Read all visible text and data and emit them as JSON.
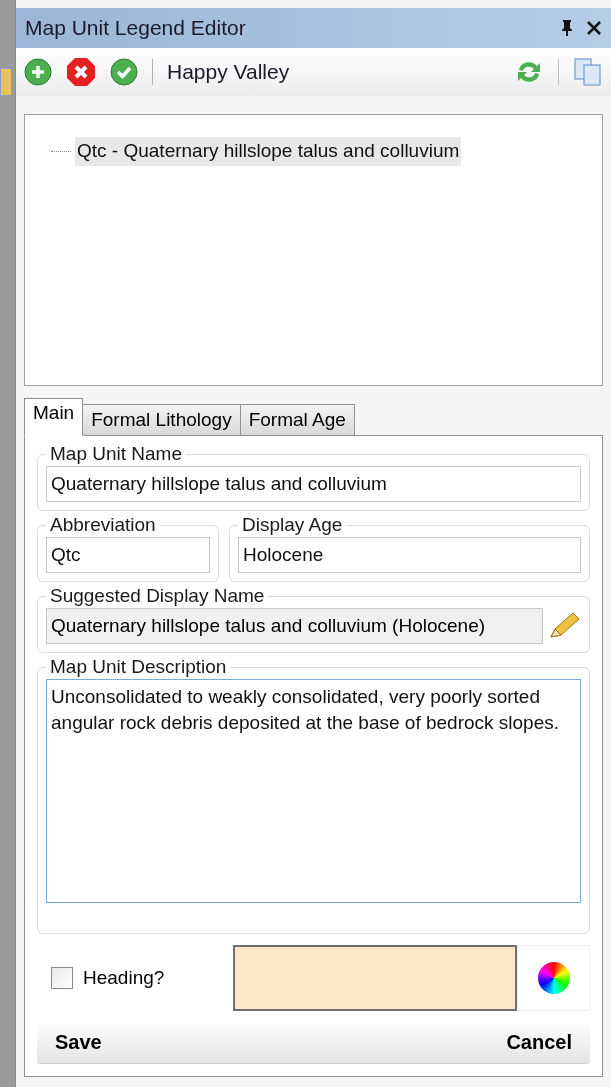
{
  "window": {
    "title": "Map Unit Legend Editor"
  },
  "toolbar": {
    "dataset": "Happy Valley"
  },
  "tree": {
    "items": [
      {
        "label": "Qtc - Quaternary hillslope talus and colluvium",
        "selected": true
      }
    ]
  },
  "tabs": [
    {
      "label": "Main",
      "selected": true
    },
    {
      "label": "Formal Lithology",
      "selected": false
    },
    {
      "label": "Formal Age",
      "selected": false
    }
  ],
  "form": {
    "map_unit_name": {
      "label": "Map Unit Name",
      "value": "Quaternary hillslope talus and colluvium"
    },
    "abbreviation": {
      "label": "Abbreviation",
      "value": "Qtc"
    },
    "display_age": {
      "label": "Display Age",
      "value": "Holocene"
    },
    "suggested_display_name": {
      "label": "Suggested Display Name",
      "value": "Quaternary hillslope talus and colluvium (Holocene)"
    },
    "description": {
      "label": "Map Unit Description",
      "value": "Unconsolidated to weakly consolidated, very poorly sorted angular rock debris deposited at the base of bedrock slopes."
    },
    "heading": {
      "label": "Heading?",
      "checked": false
    },
    "swatch": {
      "color": "#fae8c8"
    }
  },
  "buttons": {
    "save": "Save",
    "cancel": "Cancel"
  }
}
